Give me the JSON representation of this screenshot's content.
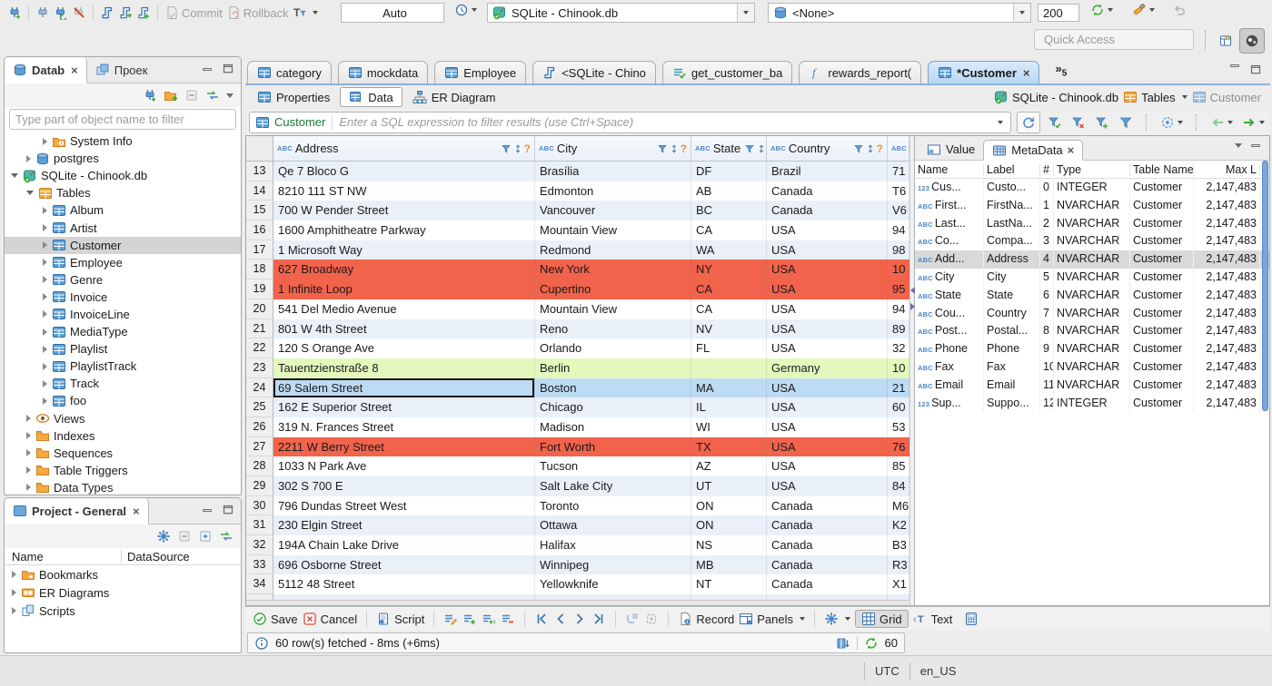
{
  "window": {
    "quick_access_placeholder": "Quick Access"
  },
  "toolbar": {
    "commit_label": "Commit",
    "rollback_label": "Rollback",
    "auto_commit": "Auto",
    "connection": "SQLite - Chinook.db",
    "schema": "<None>",
    "fetch_size": "200"
  },
  "navigator": {
    "tab_database": "Datab",
    "tab_project": "Проек",
    "filter_placeholder": "Type part of object name to filter",
    "tree": [
      {
        "label": "System Info",
        "icon": "folder-info",
        "indent": 42,
        "arrow": "collapsed"
      },
      {
        "label": "postgres",
        "icon": "database",
        "indent": 24,
        "arrow": "collapsed"
      },
      {
        "label": "SQLite - Chinook.db",
        "icon": "sqlite-connection",
        "indent": 7,
        "arrow": "expanded"
      },
      {
        "label": "Tables",
        "icon": "tables-folder",
        "indent": 24,
        "arrow": "expanded"
      },
      {
        "label": "Album",
        "icon": "table",
        "indent": 42,
        "arrow": "collapsed"
      },
      {
        "label": "Artist",
        "icon": "table",
        "indent": 42,
        "arrow": "collapsed"
      },
      {
        "label": "Customer",
        "icon": "table",
        "indent": 42,
        "arrow": "collapsed",
        "selected": true
      },
      {
        "label": "Employee",
        "icon": "table",
        "indent": 42,
        "arrow": "collapsed"
      },
      {
        "label": "Genre",
        "icon": "table",
        "indent": 42,
        "arrow": "collapsed"
      },
      {
        "label": "Invoice",
        "icon": "table",
        "indent": 42,
        "arrow": "collapsed"
      },
      {
        "label": "InvoiceLine",
        "icon": "table",
        "indent": 42,
        "arrow": "collapsed"
      },
      {
        "label": "MediaType",
        "icon": "table",
        "indent": 42,
        "arrow": "collapsed"
      },
      {
        "label": "Playlist",
        "icon": "table",
        "indent": 42,
        "arrow": "collapsed"
      },
      {
        "label": "PlaylistTrack",
        "icon": "table",
        "indent": 42,
        "arrow": "collapsed"
      },
      {
        "label": "Track",
        "icon": "table",
        "indent": 42,
        "arrow": "collapsed"
      },
      {
        "label": "foo",
        "icon": "table",
        "indent": 42,
        "arrow": "collapsed"
      },
      {
        "label": "Views",
        "icon": "views",
        "indent": 24,
        "arrow": "collapsed"
      },
      {
        "label": "Indexes",
        "icon": "folder",
        "indent": 24,
        "arrow": "collapsed"
      },
      {
        "label": "Sequences",
        "icon": "folder",
        "indent": 24,
        "arrow": "collapsed"
      },
      {
        "label": "Table Triggers",
        "icon": "folder",
        "indent": 24,
        "arrow": "collapsed"
      },
      {
        "label": "Data Types",
        "icon": "folder",
        "indent": 24,
        "arrow": "collapsed"
      }
    ]
  },
  "project": {
    "title": "Project - General",
    "columns": [
      "Name",
      "DataSource"
    ],
    "tree": [
      {
        "label": "Bookmarks",
        "icon": "bookmarks-folder"
      },
      {
        "label": "ER Diagrams",
        "icon": "er-diagrams"
      },
      {
        "label": "Scripts",
        "icon": "scripts"
      }
    ]
  },
  "editor": {
    "tabs": [
      {
        "label": "category",
        "icon": "table"
      },
      {
        "label": "mockdata",
        "icon": "table"
      },
      {
        "label": "Employee",
        "icon": "table"
      },
      {
        "label": "<SQLite - Chino",
        "icon": "sql-script"
      },
      {
        "label": "get_customer_ba",
        "icon": "view"
      },
      {
        "label": "rewards_report(",
        "icon": "function"
      },
      {
        "label": "*Customer",
        "icon": "table",
        "active": true
      }
    ],
    "hidden_tabs_count": "5",
    "subtabs": [
      {
        "label": "Properties",
        "icon": "properties"
      },
      {
        "label": "Data",
        "icon": "data",
        "active": true
      },
      {
        "label": "ER Diagram",
        "icon": "er-diagram"
      }
    ],
    "breadcrumb": {
      "connection": "SQLite - Chinook.db",
      "container": "Tables",
      "entity": "Customer"
    },
    "filter_entity": "Customer",
    "filter_placeholder": "Enter a SQL expression to filter results (use Ctrl+Space)"
  },
  "grid": {
    "columns": [
      "Address",
      "City",
      "State",
      "Country",
      ""
    ],
    "rows": [
      {
        "num": "13",
        "cells": [
          "Qe 7 Bloco G",
          "Brasília",
          "DF",
          "Brazil",
          "71"
        ],
        "style": "odd"
      },
      {
        "num": "14",
        "cells": [
          "8210 111 ST NW",
          "Edmonton",
          "AB",
          "Canada",
          "T6"
        ],
        "style": "even"
      },
      {
        "num": "15",
        "cells": [
          "700 W Pender Street",
          "Vancouver",
          "BC",
          "Canada",
          "V6"
        ],
        "style": "odd"
      },
      {
        "num": "16",
        "cells": [
          "1600 Amphitheatre Parkway",
          "Mountain View",
          "CA",
          "USA",
          "94"
        ],
        "style": "even"
      },
      {
        "num": "17",
        "cells": [
          "1 Microsoft Way",
          "Redmond",
          "WA",
          "USA",
          "98"
        ],
        "style": "odd"
      },
      {
        "num": "18",
        "cells": [
          "627 Broadway",
          "New York",
          "NY",
          "USA",
          "10"
        ],
        "style": "red"
      },
      {
        "num": "19",
        "cells": [
          "1 Infinite Loop",
          "Cupertino",
          "CA",
          "USA",
          "95"
        ],
        "style": "red"
      },
      {
        "num": "20",
        "cells": [
          "541 Del Medio Avenue",
          "Mountain View",
          "CA",
          "USA",
          "94"
        ],
        "style": "even"
      },
      {
        "num": "21",
        "cells": [
          "801 W 4th Street",
          "Reno",
          "NV",
          "USA",
          "89"
        ],
        "style": "odd"
      },
      {
        "num": "22",
        "cells": [
          "120 S Orange Ave",
          "Orlando",
          "FL",
          "USA",
          "32"
        ],
        "style": "even"
      },
      {
        "num": "23",
        "cells": [
          "Tauentzienstraße 8",
          "Berlin",
          "",
          "Germany",
          "10"
        ],
        "style": "green"
      },
      {
        "num": "24",
        "cells": [
          "69 Salem Street",
          "Boston",
          "MA",
          "USA",
          "21"
        ],
        "style": "selected"
      },
      {
        "num": "25",
        "cells": [
          "162 E Superior Street",
          "Chicago",
          "IL",
          "USA",
          "60"
        ],
        "style": "odd"
      },
      {
        "num": "26",
        "cells": [
          "319 N. Frances Street",
          "Madison",
          "WI",
          "USA",
          "53"
        ],
        "style": "even"
      },
      {
        "num": "27",
        "cells": [
          "2211 W Berry Street",
          "Fort Worth",
          "TX",
          "USA",
          "76"
        ],
        "style": "red"
      },
      {
        "num": "28",
        "cells": [
          "1033 N Park Ave",
          "Tucson",
          "AZ",
          "USA",
          "85"
        ],
        "style": "even"
      },
      {
        "num": "29",
        "cells": [
          "302 S 700 E",
          "Salt Lake City",
          "UT",
          "USA",
          "84"
        ],
        "style": "odd"
      },
      {
        "num": "30",
        "cells": [
          "796 Dundas Street West",
          "Toronto",
          "ON",
          "Canada",
          "M6"
        ],
        "style": "even"
      },
      {
        "num": "31",
        "cells": [
          "230 Elgin Street",
          "Ottawa",
          "ON",
          "Canada",
          "K2"
        ],
        "style": "odd"
      },
      {
        "num": "32",
        "cells": [
          "194A Chain Lake Drive",
          "Halifax",
          "NS",
          "Canada",
          "B3"
        ],
        "style": "even"
      },
      {
        "num": "33",
        "cells": [
          "696 Osborne Street",
          "Winnipeg",
          "MB",
          "Canada",
          "R3"
        ],
        "style": "odd"
      },
      {
        "num": "34",
        "cells": [
          "5112 48 Street",
          "Yellowknife",
          "NT",
          "Canada",
          "X1"
        ],
        "style": "even"
      }
    ]
  },
  "metadata": {
    "tab_value": "Value",
    "tab_metadata": "MetaData",
    "columns": [
      "Name",
      "Label",
      "#",
      "Type",
      "Table Name",
      "Max L"
    ],
    "rows": [
      {
        "kind": "123",
        "name": "Cus...",
        "label": "Custo...",
        "ord": "0",
        "type": "INTEGER",
        "table": "Customer",
        "max_length": "2,147,483"
      },
      {
        "kind": "ABC",
        "name": "First...",
        "label": "FirstNa...",
        "ord": "1",
        "type": "NVARCHAR",
        "table": "Customer",
        "max_length": "2,147,483"
      },
      {
        "kind": "ABC",
        "name": "Last...",
        "label": "LastNa...",
        "ord": "2",
        "type": "NVARCHAR",
        "table": "Customer",
        "max_length": "2,147,483"
      },
      {
        "kind": "ABC",
        "name": "Co...",
        "label": "Compa...",
        "ord": "3",
        "type": "NVARCHAR",
        "table": "Customer",
        "max_length": "2,147,483"
      },
      {
        "kind": "ABC",
        "name": "Add...",
        "label": "Address",
        "ord": "4",
        "type": "NVARCHAR",
        "table": "Customer",
        "max_length": "2,147,483",
        "selected": true
      },
      {
        "kind": "ABC",
        "name": "City",
        "label": "City",
        "ord": "5",
        "type": "NVARCHAR",
        "table": "Customer",
        "max_length": "2,147,483"
      },
      {
        "kind": "ABC",
        "name": "State",
        "label": "State",
        "ord": "6",
        "type": "NVARCHAR",
        "table": "Customer",
        "max_length": "2,147,483"
      },
      {
        "kind": "ABC",
        "name": "Cou...",
        "label": "Country",
        "ord": "7",
        "type": "NVARCHAR",
        "table": "Customer",
        "max_length": "2,147,483"
      },
      {
        "kind": "ABC",
        "name": "Post...",
        "label": "Postal...",
        "ord": "8",
        "type": "NVARCHAR",
        "table": "Customer",
        "max_length": "2,147,483"
      },
      {
        "kind": "ABC",
        "name": "Phone",
        "label": "Phone",
        "ord": "9",
        "type": "NVARCHAR",
        "table": "Customer",
        "max_length": "2,147,483"
      },
      {
        "kind": "ABC",
        "name": "Fax",
        "label": "Fax",
        "ord": "10",
        "type": "NVARCHAR",
        "table": "Customer",
        "max_length": "2,147,483"
      },
      {
        "kind": "ABC",
        "name": "Email",
        "label": "Email",
        "ord": "11",
        "type": "NVARCHAR",
        "table": "Customer",
        "max_length": "2,147,483"
      },
      {
        "kind": "123",
        "name": "Sup...",
        "label": "Suppo...",
        "ord": "12",
        "type": "INTEGER",
        "table": "Customer",
        "max_length": "2,147,483"
      }
    ]
  },
  "result_toolbar": {
    "save": "Save",
    "cancel": "Cancel",
    "script": "Script",
    "record": "Record",
    "panels": "Panels",
    "grid": "Grid",
    "text": "Text"
  },
  "status": {
    "message": "60 row(s) fetched - 8ms (+6ms)",
    "fetch_count": "60",
    "timezone": "UTC",
    "locale": "en_US"
  }
}
